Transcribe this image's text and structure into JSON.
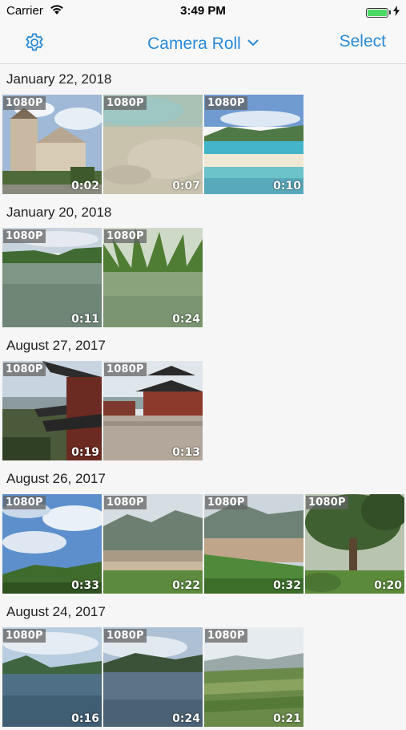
{
  "status_bar": {
    "carrier": "Carrier",
    "time": "3:49 PM",
    "battery_level": 1.0,
    "charging": true
  },
  "navbar": {
    "title": "Camera Roll",
    "select_label": "Select",
    "settings_icon": "gear-icon",
    "dropdown_icon": "chevron-down-icon",
    "accent_color": "#2a8ad6"
  },
  "sections": [
    {
      "date": "January 22, 2018",
      "videos": [
        {
          "resolution": "1080P",
          "duration": "0:02",
          "scene": "church"
        },
        {
          "resolution": "1080P",
          "duration": "0:07",
          "scene": "shallow-water"
        },
        {
          "resolution": "1080P",
          "duration": "0:10",
          "scene": "beach"
        }
      ]
    },
    {
      "date": "January 20, 2018",
      "videos": [
        {
          "resolution": "1080P",
          "duration": "0:11",
          "scene": "river"
        },
        {
          "resolution": "1080P",
          "duration": "0:24",
          "scene": "palms-river"
        }
      ]
    },
    {
      "date": "August 27, 2017",
      "videos": [
        {
          "resolution": "1080P",
          "duration": "0:19",
          "scene": "pagoda-view"
        },
        {
          "resolution": "1080P",
          "duration": "0:13",
          "scene": "pagoda-square"
        }
      ]
    },
    {
      "date": "August 26, 2017",
      "videos": [
        {
          "resolution": "1080P",
          "duration": "0:33",
          "scene": "sky-hills"
        },
        {
          "resolution": "1080P",
          "duration": "0:22",
          "scene": "mountain-valley"
        },
        {
          "resolution": "1080P",
          "duration": "0:32",
          "scene": "river-grass"
        },
        {
          "resolution": "1080P",
          "duration": "0:20",
          "scene": "tree"
        }
      ]
    },
    {
      "date": "August 24, 2017",
      "videos": [
        {
          "resolution": "1080P",
          "duration": "0:16",
          "scene": "lake"
        },
        {
          "resolution": "1080P",
          "duration": "0:24",
          "scene": "lake-hills"
        },
        {
          "resolution": "1080P",
          "duration": "0:21",
          "scene": "valley-terraces"
        }
      ]
    }
  ]
}
